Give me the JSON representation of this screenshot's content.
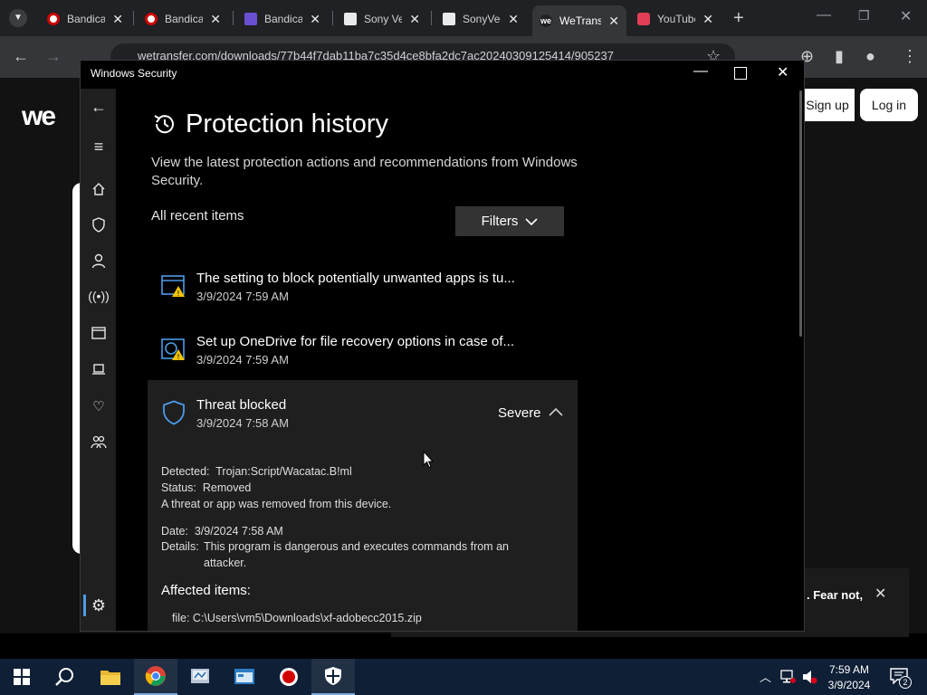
{
  "browser": {
    "tabs": [
      {
        "label": "Bandicam",
        "icon": "bandicam-icon"
      },
      {
        "label": "Bandicam",
        "icon": "bandicam-icon"
      },
      {
        "label": "Bandicam",
        "icon": "bandicam-doc-icon"
      },
      {
        "label": "Sony Vegas",
        "icon": "museum-icon"
      },
      {
        "label": "SonyVegas",
        "icon": "museum-icon"
      },
      {
        "label": "WeTransfer",
        "icon": "wetransfer-icon"
      },
      {
        "label": "YouTube",
        "icon": "download-icon"
      }
    ],
    "url": "wetransfer.com/downloads/77b44f7dab11ba7c35d4ce8bfa2dc7ac20240309125414/905237"
  },
  "site": {
    "logo": "we",
    "signup": "Sign up",
    "login": "Log in",
    "toast_text": ". Fear not,"
  },
  "window": {
    "title": "Windows Security"
  },
  "page": {
    "title": "Protection history",
    "description": "View the latest protection actions and recommendations from Windows Security.",
    "section_label": "All recent items",
    "filters_label": "Filters"
  },
  "items": [
    {
      "title": "The setting to block potentially unwanted apps is tu...",
      "date": "3/9/2024 7:59 AM"
    },
    {
      "title": "Set up OneDrive for file recovery options in case of...",
      "date": "3/9/2024 7:59 AM"
    },
    {
      "title": "Threat blocked",
      "date": "3/9/2024 7:58 AM",
      "severity": "Severe"
    }
  ],
  "details": {
    "detected_label": "Detected:",
    "detected_value": "Trojan:Script/Wacatac.B!ml",
    "status_label": "Status:",
    "status_value": "Removed",
    "status_note": "A threat or app was removed from this device.",
    "date_label": "Date:",
    "date_value": "3/9/2024 7:58 AM",
    "details_label": "Details:",
    "details_line1": "This program is dangerous and executes commands from an",
    "details_line2": "attacker.",
    "affected_label": "Affected items:",
    "affected_file": "file: C:\\Users\\vm5\\Downloads\\xf-adobecc2015.zip"
  },
  "taskbar": {
    "time": "7:59 AM",
    "date": "3/9/2024",
    "notifications": "2"
  },
  "colors": {
    "accent": "#4c9be8",
    "warning": "#f5c400",
    "taskbar": "#0f1f36"
  }
}
